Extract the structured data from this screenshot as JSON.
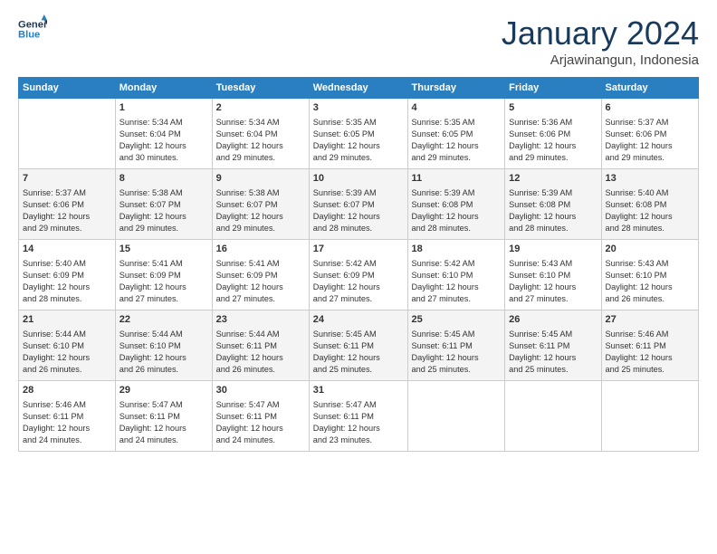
{
  "logo": {
    "line1": "General",
    "line2": "Blue"
  },
  "title": "January 2024",
  "location": "Arjawinangun, Indonesia",
  "days_header": [
    "Sunday",
    "Monday",
    "Tuesday",
    "Wednesday",
    "Thursday",
    "Friday",
    "Saturday"
  ],
  "weeks": [
    [
      {
        "day": "",
        "content": ""
      },
      {
        "day": "1",
        "content": "Sunrise: 5:34 AM\nSunset: 6:04 PM\nDaylight: 12 hours\nand 30 minutes."
      },
      {
        "day": "2",
        "content": "Sunrise: 5:34 AM\nSunset: 6:04 PM\nDaylight: 12 hours\nand 29 minutes."
      },
      {
        "day": "3",
        "content": "Sunrise: 5:35 AM\nSunset: 6:05 PM\nDaylight: 12 hours\nand 29 minutes."
      },
      {
        "day": "4",
        "content": "Sunrise: 5:35 AM\nSunset: 6:05 PM\nDaylight: 12 hours\nand 29 minutes."
      },
      {
        "day": "5",
        "content": "Sunrise: 5:36 AM\nSunset: 6:06 PM\nDaylight: 12 hours\nand 29 minutes."
      },
      {
        "day": "6",
        "content": "Sunrise: 5:37 AM\nSunset: 6:06 PM\nDaylight: 12 hours\nand 29 minutes."
      }
    ],
    [
      {
        "day": "7",
        "content": "Sunrise: 5:37 AM\nSunset: 6:06 PM\nDaylight: 12 hours\nand 29 minutes."
      },
      {
        "day": "8",
        "content": "Sunrise: 5:38 AM\nSunset: 6:07 PM\nDaylight: 12 hours\nand 29 minutes."
      },
      {
        "day": "9",
        "content": "Sunrise: 5:38 AM\nSunset: 6:07 PM\nDaylight: 12 hours\nand 29 minutes."
      },
      {
        "day": "10",
        "content": "Sunrise: 5:39 AM\nSunset: 6:07 PM\nDaylight: 12 hours\nand 28 minutes."
      },
      {
        "day": "11",
        "content": "Sunrise: 5:39 AM\nSunset: 6:08 PM\nDaylight: 12 hours\nand 28 minutes."
      },
      {
        "day": "12",
        "content": "Sunrise: 5:39 AM\nSunset: 6:08 PM\nDaylight: 12 hours\nand 28 minutes."
      },
      {
        "day": "13",
        "content": "Sunrise: 5:40 AM\nSunset: 6:08 PM\nDaylight: 12 hours\nand 28 minutes."
      }
    ],
    [
      {
        "day": "14",
        "content": "Sunrise: 5:40 AM\nSunset: 6:09 PM\nDaylight: 12 hours\nand 28 minutes."
      },
      {
        "day": "15",
        "content": "Sunrise: 5:41 AM\nSunset: 6:09 PM\nDaylight: 12 hours\nand 27 minutes."
      },
      {
        "day": "16",
        "content": "Sunrise: 5:41 AM\nSunset: 6:09 PM\nDaylight: 12 hours\nand 27 minutes."
      },
      {
        "day": "17",
        "content": "Sunrise: 5:42 AM\nSunset: 6:09 PM\nDaylight: 12 hours\nand 27 minutes."
      },
      {
        "day": "18",
        "content": "Sunrise: 5:42 AM\nSunset: 6:10 PM\nDaylight: 12 hours\nand 27 minutes."
      },
      {
        "day": "19",
        "content": "Sunrise: 5:43 AM\nSunset: 6:10 PM\nDaylight: 12 hours\nand 27 minutes."
      },
      {
        "day": "20",
        "content": "Sunrise: 5:43 AM\nSunset: 6:10 PM\nDaylight: 12 hours\nand 26 minutes."
      }
    ],
    [
      {
        "day": "21",
        "content": "Sunrise: 5:44 AM\nSunset: 6:10 PM\nDaylight: 12 hours\nand 26 minutes."
      },
      {
        "day": "22",
        "content": "Sunrise: 5:44 AM\nSunset: 6:10 PM\nDaylight: 12 hours\nand 26 minutes."
      },
      {
        "day": "23",
        "content": "Sunrise: 5:44 AM\nSunset: 6:11 PM\nDaylight: 12 hours\nand 26 minutes."
      },
      {
        "day": "24",
        "content": "Sunrise: 5:45 AM\nSunset: 6:11 PM\nDaylight: 12 hours\nand 25 minutes."
      },
      {
        "day": "25",
        "content": "Sunrise: 5:45 AM\nSunset: 6:11 PM\nDaylight: 12 hours\nand 25 minutes."
      },
      {
        "day": "26",
        "content": "Sunrise: 5:45 AM\nSunset: 6:11 PM\nDaylight: 12 hours\nand 25 minutes."
      },
      {
        "day": "27",
        "content": "Sunrise: 5:46 AM\nSunset: 6:11 PM\nDaylight: 12 hours\nand 25 minutes."
      }
    ],
    [
      {
        "day": "28",
        "content": "Sunrise: 5:46 AM\nSunset: 6:11 PM\nDaylight: 12 hours\nand 24 minutes."
      },
      {
        "day": "29",
        "content": "Sunrise: 5:47 AM\nSunset: 6:11 PM\nDaylight: 12 hours\nand 24 minutes."
      },
      {
        "day": "30",
        "content": "Sunrise: 5:47 AM\nSunset: 6:11 PM\nDaylight: 12 hours\nand 24 minutes."
      },
      {
        "day": "31",
        "content": "Sunrise: 5:47 AM\nSunset: 6:11 PM\nDaylight: 12 hours\nand 23 minutes."
      },
      {
        "day": "",
        "content": ""
      },
      {
        "day": "",
        "content": ""
      },
      {
        "day": "",
        "content": ""
      }
    ]
  ]
}
